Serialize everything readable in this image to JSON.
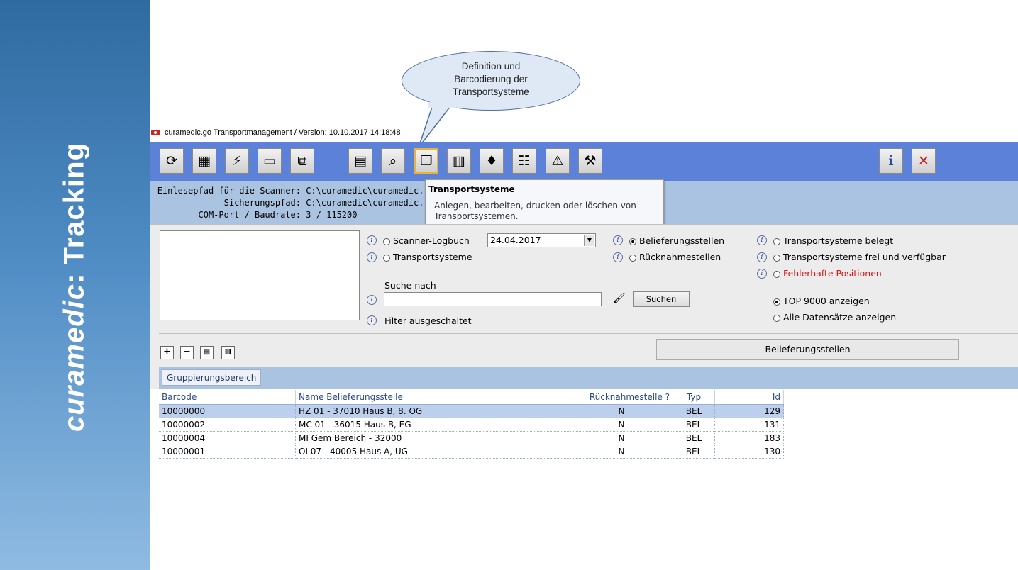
{
  "sidebar": {
    "title_italic": "curamedic",
    "title_rest": ": Tracking"
  },
  "callout": {
    "text_lines": [
      "Definition und",
      "Barcodierung der",
      "Transportsysteme"
    ]
  },
  "window": {
    "title": "curamedic.go Transportmanagement / Version: 10.10.2017 14:18:48"
  },
  "toolbar": {
    "buttons": [
      {
        "icon": "sync-icon",
        "glyph": "⟳"
      },
      {
        "icon": "pc-icon",
        "glyph": "▦"
      },
      {
        "icon": "scanner-icon",
        "glyph": "⚡"
      },
      {
        "icon": "printer-icon",
        "glyph": "▭"
      },
      {
        "icon": "network-icon",
        "glyph": "⧉"
      },
      {
        "icon": "report-icon",
        "glyph": "▤"
      },
      {
        "icon": "search-document-icon",
        "glyph": "⌕"
      },
      {
        "icon": "transport-boxes-icon",
        "glyph": "❐"
      },
      {
        "icon": "door-icon",
        "glyph": "▥"
      },
      {
        "icon": "location-pin-icon",
        "glyph": "♦"
      },
      {
        "icon": "settings-list-icon",
        "glyph": "☷"
      },
      {
        "icon": "warning-icon",
        "glyph": "⚠"
      },
      {
        "icon": "tools-icon",
        "glyph": "⚒"
      }
    ],
    "info_glyph": "i",
    "close_glyph": "✕"
  },
  "info": {
    "scanner_label": "Einlesepfad für die Scanner:",
    "scanner_value": "C:\\curamedic\\curamedic.",
    "backup_label": "Sicherungspfad:",
    "backup_value": "C:\\curamedic\\curamedic.",
    "com_label": "COM-Port / Baudrate:",
    "com_value": "3 / 115200"
  },
  "tooltip": {
    "title": "Transportsysteme",
    "body": "Anlegen, bearbeiten, drucken oder löschen von Transportsystemen."
  },
  "filter": {
    "scanner_logbuch": "Scanner-Logbuch",
    "date": "24.04.2017",
    "transportsysteme": "Transportsysteme",
    "belieferungsstellen": "Belieferungsstellen",
    "ruecknahmestellen": "Rücknahmestellen",
    "ts_belegt": "Transportsysteme belegt",
    "ts_frei": "Transportsysteme frei und verfügbar",
    "fehlerhafte": "Fehlerhafte Positionen",
    "suche_nach": "Suche nach",
    "search_value": "",
    "suchen": "Suchen",
    "filter_status": "Filter ausgeschaltet",
    "top_9000": "TOP 9000 anzeigen",
    "alle": "Alle Datensätze anzeigen",
    "info_glyph": "i"
  },
  "controls": {
    "expand": "+",
    "collapse": "−",
    "columns": "Ⅲ",
    "panel_label": "Belieferungsstellen"
  },
  "grouping": {
    "label": "Gruppierungsbereich"
  },
  "grid": {
    "columns": [
      "Barcode",
      "Name Belieferungsstelle",
      "Rücknahmestelle ?",
      "Typ",
      "Id"
    ],
    "rows": [
      [
        "10000000",
        "HZ 01 - 37010 Haus B, 8. OG",
        "N",
        "BEL",
        "129"
      ],
      [
        "10000002",
        "MC 01 - 36015 Haus B, EG",
        "N",
        "BEL",
        "131"
      ],
      [
        "10000004",
        "MI Gem Bereich - 32000",
        "N",
        "BEL",
        "183"
      ],
      [
        "10000001",
        "OI 07 - 40005 Haus A, UG",
        "N",
        "BEL",
        "130"
      ]
    ]
  }
}
